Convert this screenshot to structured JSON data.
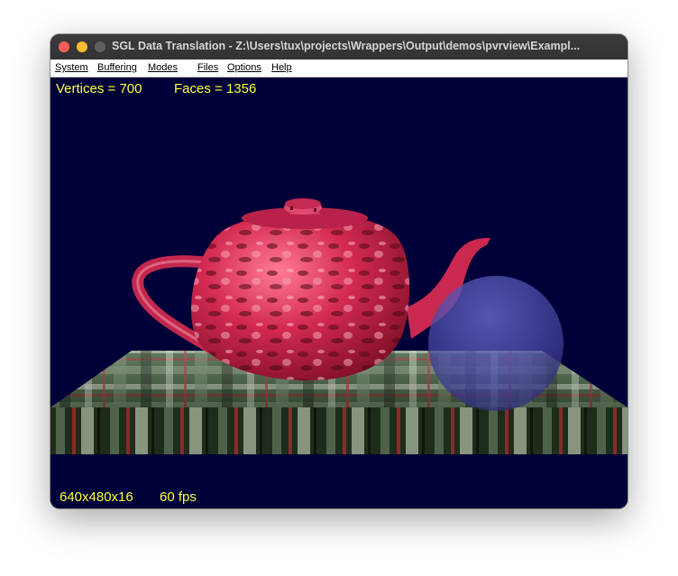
{
  "window": {
    "title": "SGL Data Translation -  Z:\\Users\\tux\\projects\\Wrappers\\Output\\demos\\pvrview\\Exampl..."
  },
  "menu": {
    "items": [
      {
        "label": "System"
      },
      {
        "label": "Buffering"
      },
      {
        "label": "Modes"
      },
      {
        "label": "Files"
      },
      {
        "label": "Options"
      },
      {
        "label": "Help"
      }
    ]
  },
  "hud": {
    "vertices": "Vertices = 700",
    "faces": "Faces = 1356",
    "resolution": "640x480x16",
    "fps": "60 fps"
  },
  "colors": {
    "background": "#000038",
    "hud_text": "#ffff3a",
    "teapot": "#d8335a",
    "sphere": "#4a4aa0",
    "floor": "#3d5a3a"
  },
  "scene": {
    "objects": [
      "teapot-icon",
      "sphere-icon",
      "tartan-floor-icon"
    ]
  }
}
